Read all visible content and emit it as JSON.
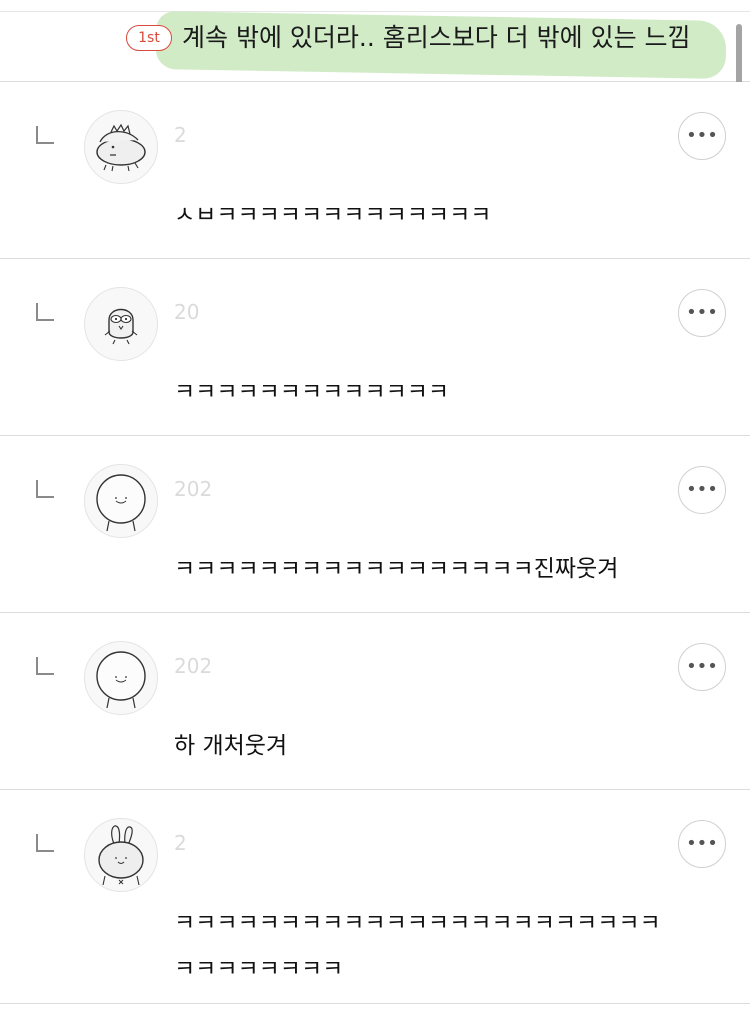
{
  "parent_comment": {
    "rank_badge": "1st",
    "text": "계속 밖에 있더라.. 홈리스보다 더 밖에 있는 느낌"
  },
  "replies": [
    {
      "nickname": "",
      "date": "2",
      "text": "ㅅㅂㅋㅋㅋㅋㅋㅋㅋㅋㅋㅋㅋㅋㅋ",
      "more_label": "•••",
      "avatar_icon": "dinosaur-avatar-icon"
    },
    {
      "nickname": "",
      "date": "20",
      "text": "ㅋㅋㅋㅋㅋㅋㅋㅋㅋㅋㅋㅋㅋ",
      "more_label": "•••",
      "avatar_icon": "chick-avatar-icon"
    },
    {
      "nickname": "",
      "date": "202",
      "text": "ㅋㅋㅋㅋㅋㅋㅋㅋㅋㅋㅋㅋㅋㅋㅋㅋㅋ진짜웃겨",
      "more_label": "•••",
      "avatar_icon": "round-face-avatar-icon"
    },
    {
      "nickname": "",
      "date": "202",
      "text": "하 개처웃겨",
      "more_label": "•••",
      "avatar_icon": "round-face-avatar-icon"
    },
    {
      "nickname": "",
      "date": "2",
      "text": "ㅋㅋㅋㅋㅋㅋㅋㅋㅋㅋㅋㅋㅋㅋㅋㅋㅋㅋㅋㅋㅋㅋㅋ\nㅋㅋㅋㅋㅋㅋㅋㅋ",
      "more_label": "•••",
      "avatar_icon": "bunny-avatar-icon"
    }
  ]
}
